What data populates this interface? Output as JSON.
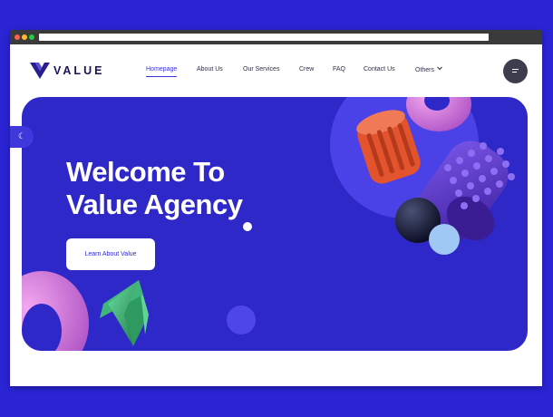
{
  "browser": {
    "dots": [
      "#ff5f56",
      "#ffbd2e",
      "#27c93f"
    ]
  },
  "logo": {
    "text": "VALUE",
    "icon": "v-logo-icon"
  },
  "nav": {
    "items": [
      "Homepage",
      "About Us",
      "Our Services",
      "Crew",
      "FAQ",
      "Contact Us",
      "Others"
    ],
    "active": "Homepage",
    "dropdown_icon": "chevron-down-icon"
  },
  "menu_button": {
    "icon": "hamburger-icon"
  },
  "theme_toggle": {
    "icon": "moon-icon",
    "glyph": "☾"
  },
  "hero": {
    "title_line1": "Welcome To",
    "title_line2": "Value Agency",
    "cta_label": "Learn About Value"
  },
  "colors": {
    "page_background": "#2a24d4",
    "hero_background": "#2f28c9",
    "accent": "#3a33d6",
    "pink": "#d27ad9",
    "orange": "#e2532e",
    "purple": "#5a3ad0",
    "green": "#3aa36a"
  }
}
